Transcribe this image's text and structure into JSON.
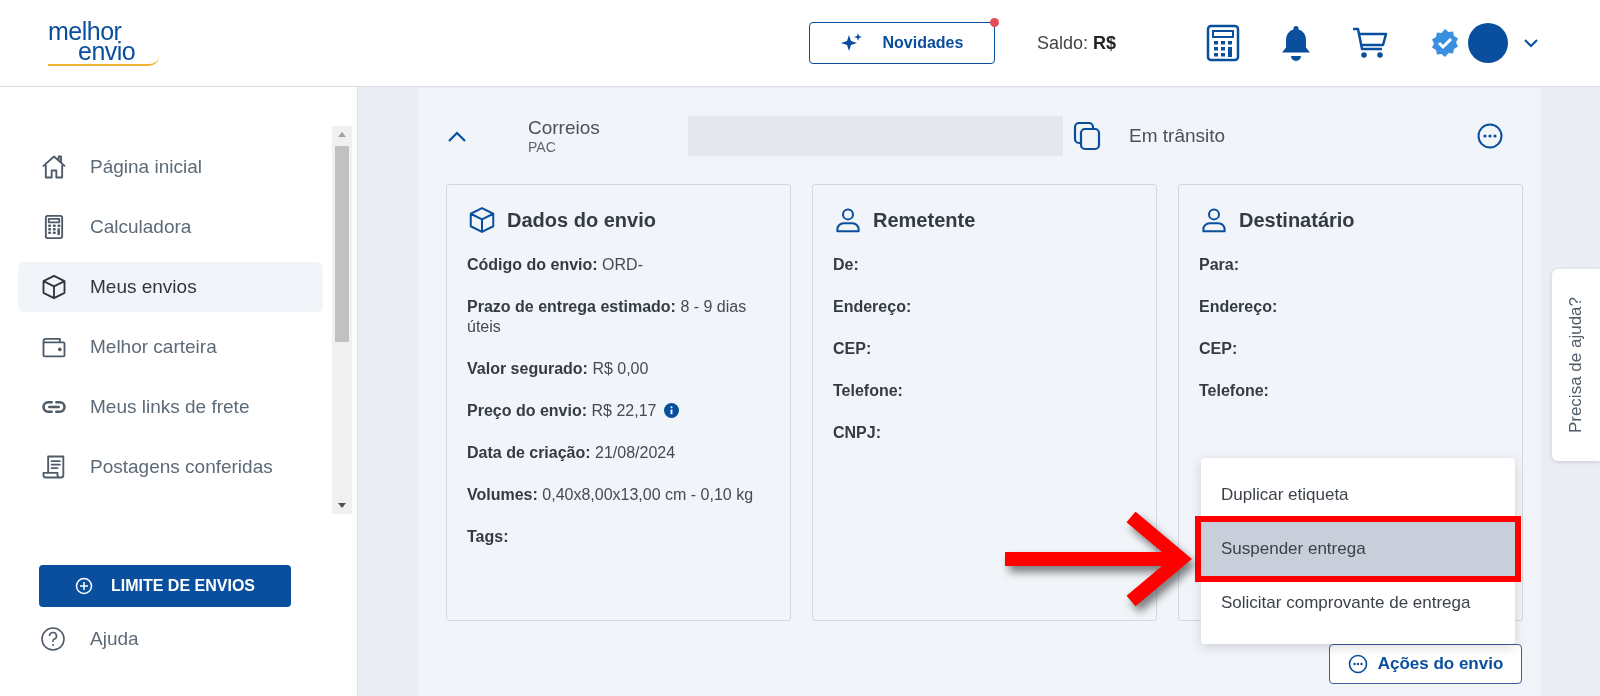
{
  "header": {
    "logo": [
      "melhor",
      "envio"
    ],
    "news_button": {
      "label": "Novidades",
      "unread": true
    },
    "balance": {
      "label": "Saldo:",
      "value": "R$"
    },
    "verified": true
  },
  "sidebar": {
    "items": [
      {
        "label": "Página inicial",
        "kind": "home",
        "selected": false
      },
      {
        "label": "Calculadora",
        "kind": "calculator",
        "selected": false
      },
      {
        "label": "Meus envios",
        "kind": "package",
        "selected": true
      },
      {
        "label": "Melhor carteira",
        "kind": "wallet",
        "selected": false
      },
      {
        "label": "Meus links de frete",
        "kind": "link",
        "selected": false
      },
      {
        "label": "Postagens conferidas",
        "kind": "receipt",
        "selected": false
      }
    ],
    "limit_button": "LIMITE DE ENVIOS",
    "help": "Ajuda"
  },
  "shipment": {
    "expanded": true,
    "carrier": "Correios",
    "service": "PAC",
    "status": "Em trânsito",
    "cards": [
      {
        "kind": "package",
        "title": "Dados do envio",
        "rows": [
          {
            "label": "Código do envio:",
            "value": "ORD-"
          },
          {
            "label": "Prazo de entrega estimado:",
            "value": "8 - 9 dias úteis"
          },
          {
            "label": "Valor segurado:",
            "value": "R$ 0,00"
          },
          {
            "label": "Preço do envio:",
            "value": "R$ 22,17",
            "info": true
          },
          {
            "label": "Data de criação:",
            "value": "21/08/2024"
          },
          {
            "label": "Volumes:",
            "value": "0,40x8,00x13,00 cm - 0,10 kg"
          },
          {
            "label": "Tags:"
          }
        ]
      },
      {
        "kind": "person",
        "title": "Remetente",
        "rows": [
          {
            "label": "De:"
          },
          {
            "label": "Endereço:"
          },
          {
            "label": "CEP:"
          },
          {
            "label": "Telefone:"
          },
          {
            "label": "CNPJ:"
          }
        ]
      },
      {
        "kind": "person",
        "title": "Destinatário",
        "rows": [
          {
            "label": "Para:"
          },
          {
            "label": "Endereço:"
          },
          {
            "label": "CEP:"
          },
          {
            "label": "Telefone:"
          }
        ]
      }
    ],
    "menu": {
      "items": [
        {
          "label": "Duplicar etiqueta",
          "selected": false,
          "annotated": false
        },
        {
          "label": "Suspender entrega",
          "selected": true,
          "annotated": true
        },
        {
          "label": "Solicitar comprovante de entrega",
          "selected": false,
          "annotated": false
        }
      ]
    },
    "actions_button": "Ações do envio"
  },
  "help_tab": "Precisa de ajuda?"
}
